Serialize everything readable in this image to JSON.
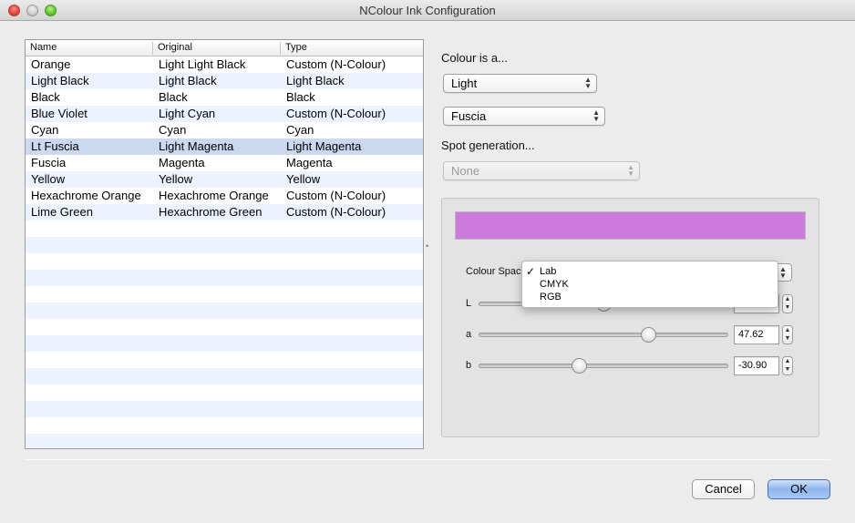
{
  "window": {
    "title": "NColour Ink Configuration"
  },
  "table": {
    "columns": [
      "Name",
      "Original",
      "Type"
    ],
    "rows": [
      [
        "Orange",
        "Light Light Black",
        "Custom (N-Colour)"
      ],
      [
        "Light Black",
        "Light Black",
        "Light Black"
      ],
      [
        "Black",
        "Black",
        "Black"
      ],
      [
        "Blue Violet",
        "Light Cyan",
        "Custom (N-Colour)"
      ],
      [
        "Cyan",
        "Cyan",
        "Cyan"
      ],
      [
        "Lt Fuscia",
        "Light Magenta",
        "Light Magenta"
      ],
      [
        "Fuscia",
        "Magenta",
        "Magenta"
      ],
      [
        "Yellow",
        "Yellow",
        "Yellow"
      ],
      [
        "Hexachrome Orange",
        "Hexachrome Orange",
        "Custom (N-Colour)"
      ],
      [
        "Lime Green",
        "Hexachrome Green",
        "Custom (N-Colour)"
      ]
    ],
    "selected_row": 5,
    "selected_color": "#cad9ef"
  },
  "colour_is": {
    "label": "Colour is a...",
    "lightness_value": "Light",
    "base_value": "Fuscia"
  },
  "spot": {
    "label": "Spot generation...",
    "value": "None"
  },
  "swatch_color": "#cc7ade",
  "colour_space": {
    "label": "Colour Space",
    "options": [
      "Lab",
      "CMYK",
      "RGB"
    ],
    "selected": "Lab"
  },
  "channels": [
    {
      "label": "L",
      "value": "",
      "level": 0.5
    },
    {
      "label": "a",
      "value": "47.62",
      "level": 0.68
    },
    {
      "label": "b",
      "value": "-30.90",
      "level": 0.4
    }
  ],
  "buttons": {
    "cancel": "Cancel",
    "ok": "OK"
  }
}
